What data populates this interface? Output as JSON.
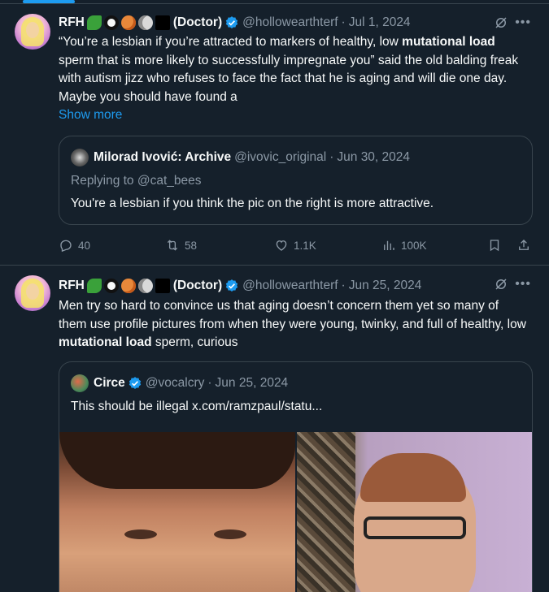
{
  "tweets": [
    {
      "author_name": "RFH",
      "author_suffix": "(Doctor)",
      "handle": "@hollowearthterf",
      "date": "Jul 1, 2024",
      "text_segments": [
        "“You’re a lesbian if you’re attracted to markers of healthy, low ",
        "mutational load",
        " sperm that is more likely to successfully impregnate you” said the old balding freak with autism jizz who refuses to face the fact that he is aging and will die one day. Maybe you should have found a"
      ],
      "show_more": "Show more",
      "quote": {
        "author_name": "Milorad Ivović: Archive",
        "handle": "@ivovic_original",
        "date": "Jun 30, 2024",
        "replying_to": "Replying to @cat_bees",
        "text": "You're a lesbian if you think the pic on the right is more attractive."
      },
      "stats": {
        "replies": "40",
        "reposts": "58",
        "likes": "1.1K",
        "views": "100K"
      }
    },
    {
      "author_name": "RFH",
      "author_suffix": "(Doctor)",
      "handle": "@hollowearthterf",
      "date": "Jun 25, 2024",
      "text_segments": [
        "Men try so hard to convince us that aging doesn’t concern them yet so many of them use profile pictures from when they were young, twinky, and full of healthy, low ",
        "mutational load",
        " sperm, curious"
      ],
      "quote": {
        "author_name": "Circe",
        "handle": "@vocalcry",
        "date": "Jun 25, 2024",
        "text": "This should be illegal  x.com/ramzpaul/statu..."
      }
    }
  ],
  "separator": "·",
  "colors": {
    "background": "#15202b",
    "text": "#f7f9f9",
    "muted": "#8b98a5",
    "accent": "#1d9bf0",
    "border": "#38444d"
  },
  "icons": {
    "verified": "verified-badge-icon",
    "grok": "grok-icon",
    "more": "more-icon",
    "reply": "reply-icon",
    "repost": "repost-icon",
    "like": "heart-icon",
    "views": "views-icon",
    "bookmark": "bookmark-icon",
    "share": "share-icon"
  }
}
